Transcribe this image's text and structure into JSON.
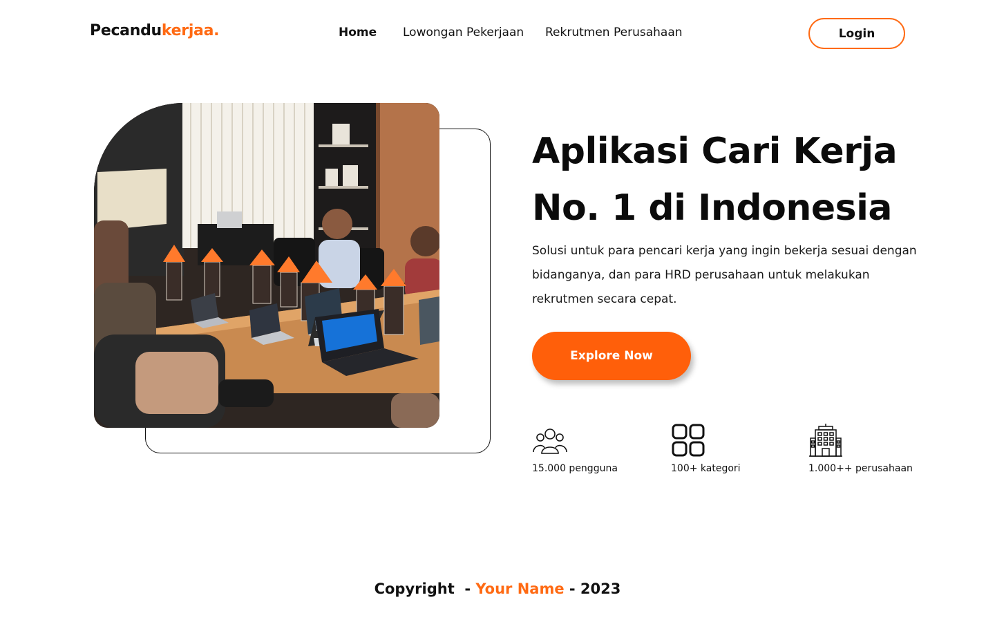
{
  "brand": {
    "part1": "Pecandu",
    "part2": "kerjaa."
  },
  "nav": {
    "home": "Home",
    "jobs": "Lowongan Pekerjaan",
    "recruitment": "Rekrutmen Perusahaan",
    "login": "Login"
  },
  "hero": {
    "headline_line1": "Aplikasi Cari Kerja",
    "headline_line2": "No. 1 di Indonesia",
    "description": "Solusi untuk para pencari kerja yang ingin bekerja sesuai dengan bidanganya, dan para HRD perusahaan untuk melakukan rekrutmen secara cepat.",
    "cta": "Explore Now",
    "photo_alt": "meeting-room-photo"
  },
  "stats": [
    {
      "icon": "users-icon",
      "label": "15.000 pengguna"
    },
    {
      "icon": "grid-icon",
      "label": "100+ kategori"
    },
    {
      "icon": "building-icon",
      "label": "1.000++ perusahaan"
    }
  ],
  "footer": {
    "prefix": "Copyright  - ",
    "name": "Your Name",
    "suffix": " - 2023"
  },
  "colors": {
    "accent": "#ff6a13",
    "button": "#ff5f0a",
    "text": "#111111"
  }
}
